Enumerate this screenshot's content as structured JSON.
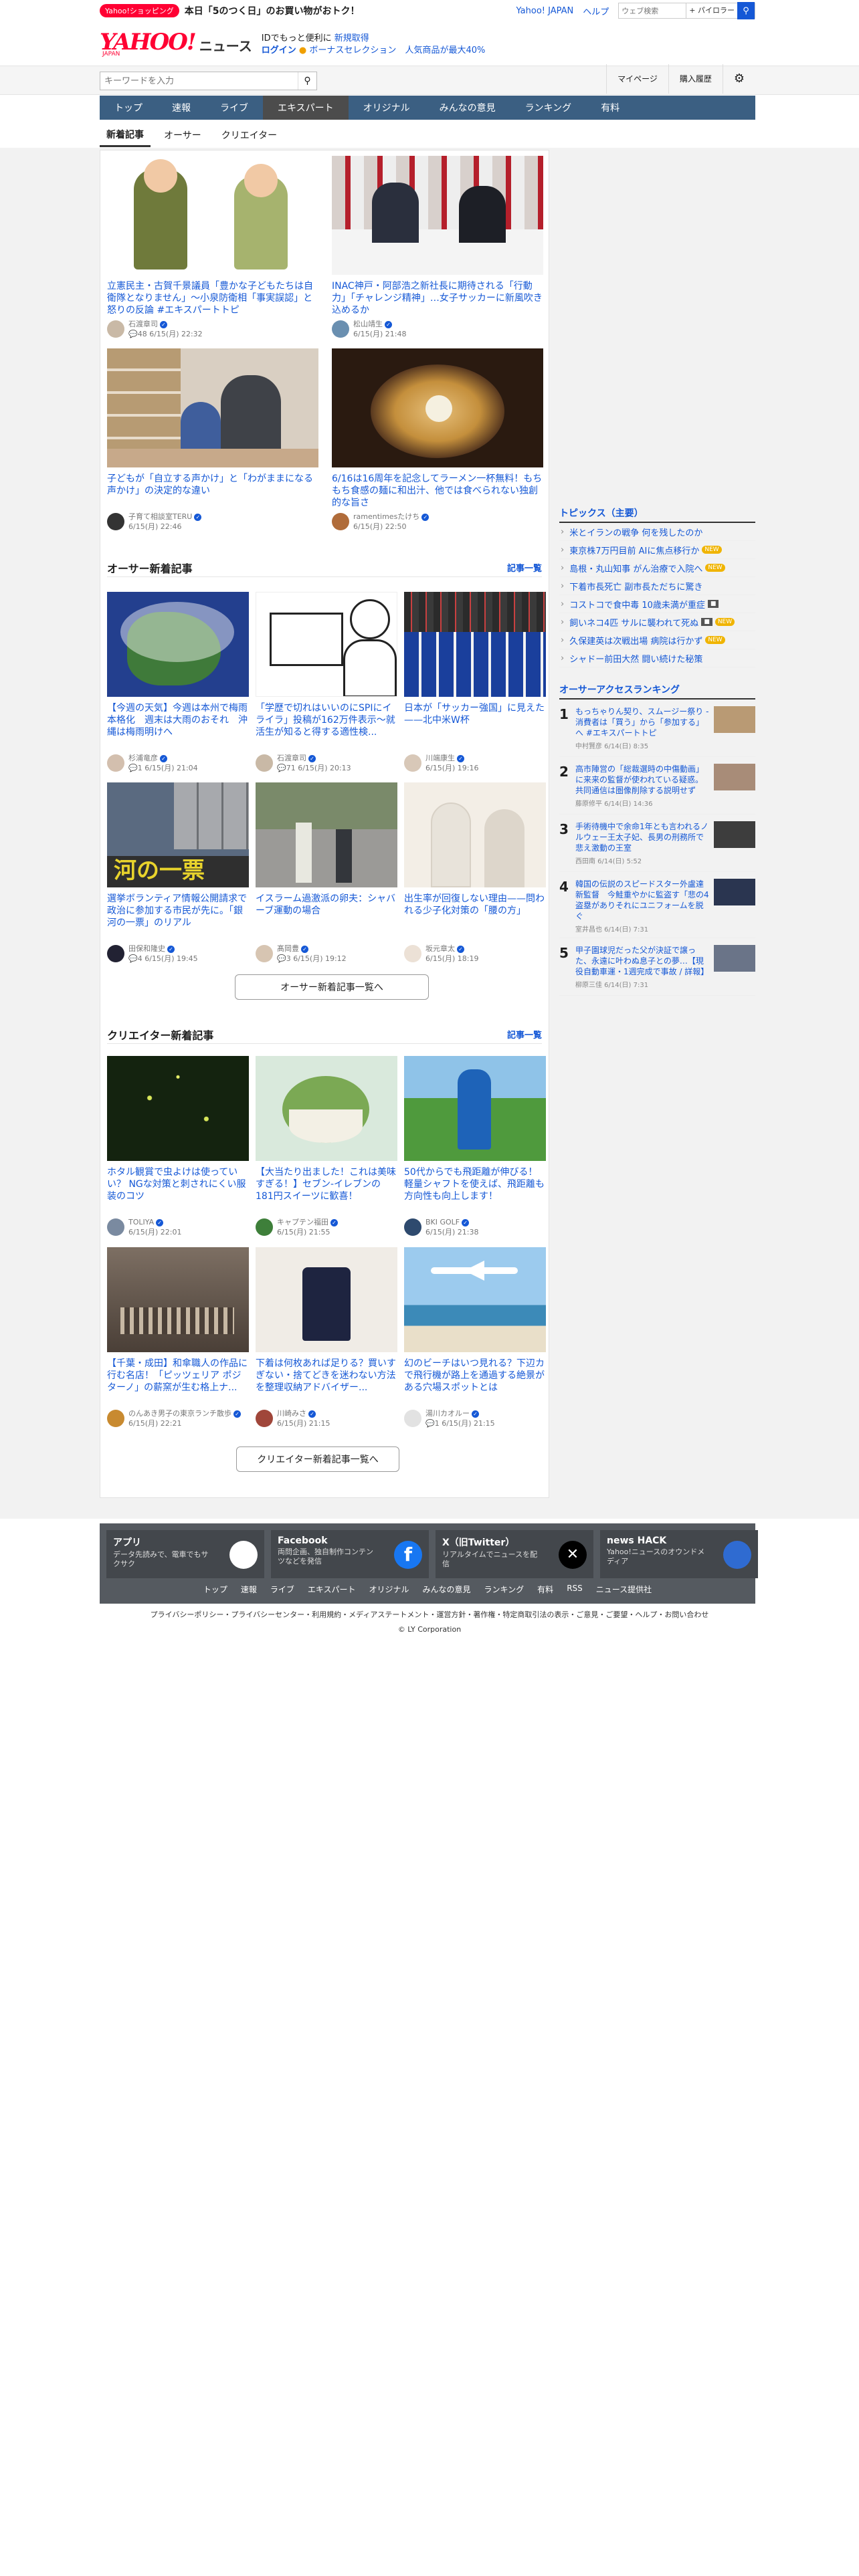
{
  "topbar": {
    "shop_badge": "Yahoo!ショッピング",
    "shop_text": "本日「5のつく日」のお買い物がおトク！",
    "link_yahoo": "Yahoo! JAPAN",
    "link_help": "ヘルプ",
    "search_placeholder": "ウェブ検索",
    "search_select": "+ パイロラー"
  },
  "header": {
    "logo": "YAHOO!",
    "logo_sub": "JAPAN",
    "news": "ニュース",
    "line1_a": "IDでもっと便利に",
    "line1_b": "新規取得",
    "login": "ログイン",
    "bonus": "ボーナスセレクション",
    "bonus_b": "人気商品が最大40%"
  },
  "search": {
    "placeholder": "キーワードを入力",
    "mypage": "マイページ",
    "history": "購入履歴"
  },
  "nav": [
    "トップ",
    "速報",
    "ライブ",
    "エキスパート",
    "オリジナル",
    "みんなの意見",
    "ランキング",
    "有料"
  ],
  "subtabs": [
    "新着記事",
    "オーサー",
    "クリエイター"
  ],
  "featured": [
    {
      "title": "立憲民主・古賀千景議員「豊かな子どもたちは自衛隊となりません」〜小泉防衛相「事実誤認」と怒りの反論 #エキスパートトピ",
      "author": "石渡章司",
      "count": "48",
      "date": "6/15(月) 22:32"
    },
    {
      "title": "INAC神戸・阿部浩之新社長に期待される「行動力」「チャレンジ精神」…女子サッカーに新風吹き込めるか",
      "author": "松山靖生",
      "count": "",
      "date": "6/15(月) 21:48"
    },
    {
      "title": "子どもが「自立する声かけ」と「わがままになる声かけ」の決定的な違い",
      "author": "子育て相談室TERU",
      "count": "",
      "date": "6/15(月) 22:46"
    },
    {
      "title": "6/16は16周年を記念してラーメン一杯無料！もちもち食感の麺に和出汁、他では食べられない独創的な旨さ",
      "author": "ramentimesたけち",
      "count": "",
      "date": "6/15(月) 22:50"
    }
  ],
  "author_section": {
    "title": "オーサー新着記事",
    "link": "記事一覧",
    "more": "オーサー新着記事一覧へ"
  },
  "author_articles": [
    {
      "title": "【今週の天気】今週は本州で梅雨本格化　週末は大雨のおそれ　沖縄は梅雨明けへ",
      "author": "杉浦竜彦",
      "count": "1",
      "date": "6/15(月) 21:04"
    },
    {
      "title": "「学歴で切れはいいのにSPIにイライラ」投稿が162万件表示〜就活生が知ると得する適性検...",
      "author": "石渡章司",
      "count": "71",
      "date": "6/15(月) 20:13"
    },
    {
      "title": "日本が「サッカー強国」に見えた——北中米W杯",
      "author": "川端康生",
      "count": "",
      "date": "6/15(月) 19:16"
    },
    {
      "title": "選挙ボランティア情報公開請求で政治に参加する市民が先に。「銀河の一票」のリアル",
      "author": "田保和隆史",
      "count": "4",
      "date": "6/15(月) 19:45"
    },
    {
      "title": "イスラーム過激派の卵夫：シャバーブ運動の場合",
      "author": "髙岡豊",
      "count": "3",
      "date": "6/15(月) 19:12"
    },
    {
      "title": "出生率が回復しない理由——問われる少子化対策の「腰の方」",
      "author": "坂元章太",
      "count": "",
      "date": "6/15(月) 18:19"
    }
  ],
  "creator_section": {
    "title": "クリエイター新着記事",
    "link": "記事一覧",
    "more": "クリエイター新着記事一覧へ"
  },
  "creator_articles": [
    {
      "title": "ホタル観賞で虫よけは使っていい？ NGな対策と刺されにくい服装のコツ",
      "author": "TOLIYA",
      "count": "",
      "date": "6/15(月) 22:01"
    },
    {
      "title": "【大当たり出ました！これは美味すぎる！】セブン-イレブンの181円スイーツに歓喜！",
      "author": "キャプテン福田",
      "count": "",
      "date": "6/15(月) 21:55"
    },
    {
      "title": "50代からでも飛距離が伸びる！軽量シャフトを使えば、飛距離も方向性も向上します！",
      "author": "BKI GOLF",
      "count": "",
      "date": "6/15(月) 21:38"
    },
    {
      "title": "【千葉・成田】和傘職人の作品に行む名店！「ピッツェリア ポジターノ」の薪窯が生む格上ナ...",
      "author": "のんあき男子の東京ランチ散歩",
      "count": "",
      "date": "6/15(月) 22:21"
    },
    {
      "title": "下着は何枚あれば足りる？買いすぎない・捨てどきを迷わない方法を整理収納アドバイザー...",
      "author": "川崎みさ",
      "count": "",
      "date": "6/15(月) 21:15"
    },
    {
      "title": "幻のビーチはいつ見れる？下辺カで飛行機が路上を通過する絶景がある穴場スポットとは",
      "author": "湯川カオルー",
      "count": "1",
      "date": "6/15(月) 21:15"
    }
  ],
  "topics": {
    "title": "トピックス（主要）",
    "items": [
      {
        "text": "米とイランの戦争 何を残したのか",
        "tag": ""
      },
      {
        "text": "東京株7万円目前 AIに焦点移行か",
        "tag": "NEW"
      },
      {
        "text": "島根・丸山知事 がん治療で入院へ",
        "tag": "NEW"
      },
      {
        "text": "下着市長死亡 副市長ただちに驚き",
        "tag": ""
      },
      {
        "text": "コストコで食中毒 10歳未満が重症",
        "tag": "cam"
      },
      {
        "text": "飼いネコ4匹 サルに襲われて死ぬ",
        "tag": "NEW"
      },
      {
        "text": "久保建英は次戦出場 病院は行かず",
        "tag": "NEW"
      },
      {
        "text": "シャドー前田大然 闘い続けた秘策",
        "tag": ""
      }
    ]
  },
  "ranking": {
    "title": "オーサーアクセスランキング",
    "items": [
      {
        "rank": "1",
        "title": "もっちゃりん契り、スムージー祭り - 消費者は「買う」から「参加する」へ #エキスパートトピ",
        "meta": "中村賢彦 6/14(日) 8:35"
      },
      {
        "rank": "2",
        "title": "高市陣営の「総裁選時の中傷動画」に来来の監督が使われている疑惑。共同通信は圏像削除する説明せず",
        "meta": "藤原修平 6/14(日) 14:36"
      },
      {
        "rank": "3",
        "title": "手術待機中で余命1年とも言われるノルウェー王太子妃、長男の刑務所で悲え激動の王室",
        "meta": "西田南 6/14(日) 5:52"
      },
      {
        "rank": "4",
        "title": "韓国の伝説のスピードスター外盧達新監督　今鮭重やかに監盗す「悲の4盗塁がありそれにユニフォームを脱ぐ",
        "meta": "室井昌也 6/14(日) 7:31"
      },
      {
        "rank": "5",
        "title": "甲子園球児だった父が決証で譲った、永遠に叶わぬ息子との夢…【現役自動車運・1週完成で事故 / 詳報】",
        "meta": "柳原三佳 6/14(日) 7:31"
      }
    ]
  },
  "footer": {
    "boxes": [
      {
        "h": "アプリ",
        "d": "データ先読みで、電車でもサクサク"
      },
      {
        "h": "Facebook",
        "d": "両問企画、独自制作コンテンツなどを発信"
      },
      {
        "h": "X（旧Twitter）",
        "d": "リアルタイムでニュースを配信"
      },
      {
        "h": "news HACK",
        "d": "Yahoo!ニュースのオウンドメディア"
      }
    ],
    "links": [
      "トップ",
      "速報",
      "ライブ",
      "エキスパート",
      "オリジナル",
      "みんなの意見",
      "ランキング",
      "有料",
      "RSS",
      "ニュース提供社"
    ],
    "bottom": "プライバシーポリシー・プライバシーセンター・利用規約・メディアステートメント・運営方針・著作権・特定商取引法の表示・ご意見・ご要望・ヘルプ・お問い合わせ",
    "copyright": "© LY Corporation"
  },
  "colors": {
    "brand": "#ff0033",
    "link": "#1558d6",
    "nav": "#3b5f82"
  }
}
